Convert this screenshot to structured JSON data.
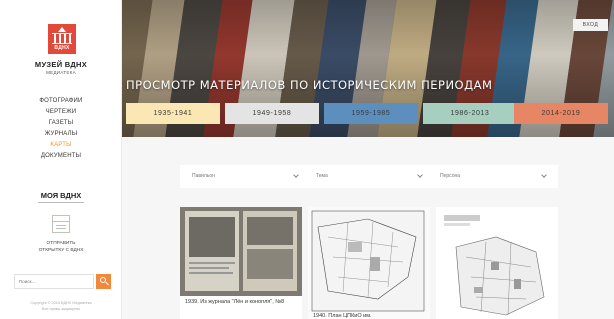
{
  "sidebar": {
    "logo_text": "ВДНХ",
    "title": "МУЗЕЙ ВДНХ",
    "subtitle": "МЕДИАТЕКА",
    "nav": [
      {
        "label": "ФОТОГРАФИИ",
        "active": false
      },
      {
        "label": "ЧЕРТЕЖИ",
        "active": false
      },
      {
        "label": "ГАЗЕТЫ",
        "active": false
      },
      {
        "label": "ЖУРНАЛЫ",
        "active": false
      },
      {
        "label": "КАРТЫ",
        "active": true
      },
      {
        "label": "ДОКУМЕНТЫ",
        "active": false
      }
    ],
    "my_link": "МОЯ ВДНХ",
    "send_line1": "ОТПРАВИТЬ",
    "send_line2": "ОТКРЫТКУ С ВДНХ",
    "search_placeholder": "Поиск...",
    "copyright_line1": "Copyright © 2019 ВДНХ Медиатека",
    "copyright_line2": "Все права защищены"
  },
  "header": {
    "login_label": "ВХОД",
    "title": "ПРОСМОТР МАТЕРИАЛОВ ПО ИСТОРИЧЕСКИМ ПЕРИОДАМ"
  },
  "periods": [
    {
      "label": "1935-1941",
      "color": "#fbe7b4"
    },
    {
      "label": "1949-1958",
      "color": "#e4e4e4"
    },
    {
      "label": "1959-1985",
      "color": "#5c8fbd"
    },
    {
      "label": "1986-2013",
      "color": "#a6cfbf"
    },
    {
      "label": "2014-2019",
      "color": "#e68665"
    }
  ],
  "filters": [
    {
      "label": "Павильон"
    },
    {
      "label": "Тема"
    },
    {
      "label": "Персона"
    }
  ],
  "cards": [
    {
      "caption": "1939. Из журнала \"Лён и конопля\", №8"
    },
    {
      "caption": "1940. План ЦПКиО им."
    },
    {
      "caption": ""
    }
  ],
  "colors": {
    "accent_orange": "#f0893c",
    "active_nav": "#e59a2e",
    "logo_red": "#e2493b"
  }
}
